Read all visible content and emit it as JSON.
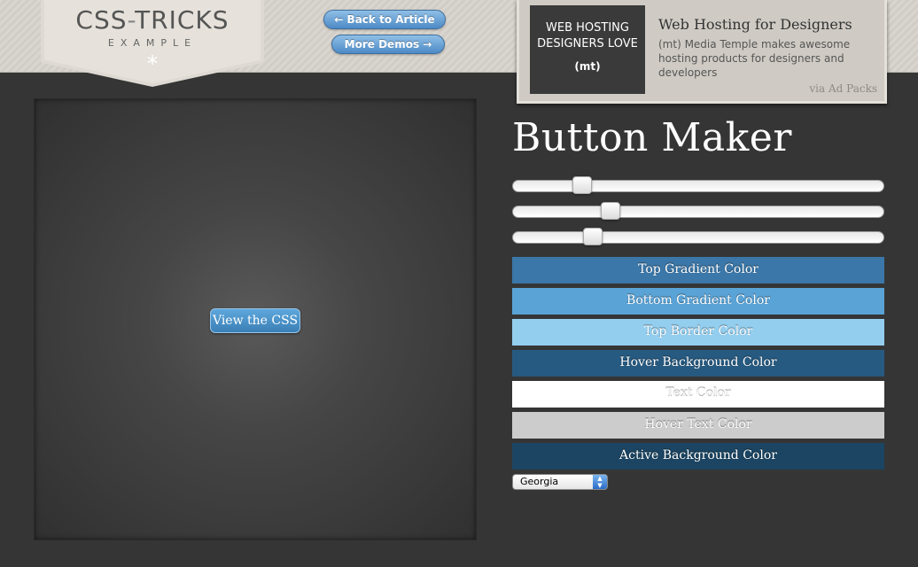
{
  "header": {
    "logo_title_a": "CSS",
    "logo_title_dash": "-",
    "logo_title_b": "TRICKS",
    "logo_subtitle": "EXAMPLE",
    "logo_glyph": "*",
    "back_button_label": "← Back to Article",
    "more_demos_label": "More Demos →"
  },
  "ad": {
    "image_line1": "WEB HOSTING",
    "image_line2": "DESIGNERS LOVE",
    "image_line3": "(mt)",
    "title": "Web Hosting for Designers",
    "text": "(mt) Media Temple makes awesome hosting products for designers and developers",
    "via": "via Ad Packs"
  },
  "preview": {
    "demo_button_label": "View the CSS"
  },
  "controls": {
    "title": "Button Maker",
    "sliders": [
      {
        "value": 0.17
      },
      {
        "value": 0.25
      },
      {
        "value": 0.2
      }
    ],
    "swatches": [
      {
        "label": "Top Gradient Color",
        "color": "#3b77a8"
      },
      {
        "label": "Bottom Gradient Color",
        "color": "#5aa3d6"
      },
      {
        "label": "Top Border Color",
        "color": "#93ceef"
      },
      {
        "label": "Hover Background Color",
        "color": "#275a80"
      },
      {
        "label": "Text Color",
        "color": "#ffffff"
      },
      {
        "label": "Hover Text Color",
        "color": "#cccccc"
      },
      {
        "label": "Active Background Color",
        "color": "#1b4562"
      }
    ],
    "font_select": {
      "selected": "Georgia"
    }
  }
}
